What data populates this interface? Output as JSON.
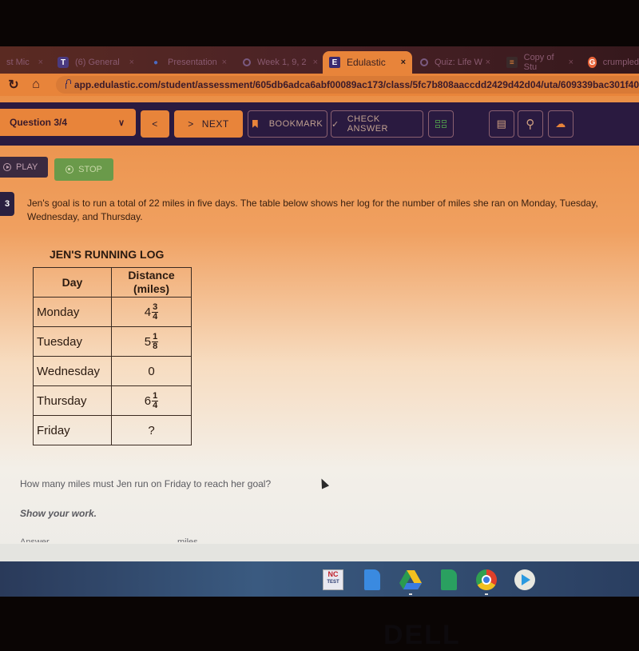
{
  "browser": {
    "tabs": [
      {
        "label": "st Mic",
        "icon": "unknown-icon",
        "active": false
      },
      {
        "label": "(6) General",
        "icon": "teams-icon",
        "active": false
      },
      {
        "label": "Presentation",
        "icon": "droplet-icon",
        "active": false
      },
      {
        "label": "Week 1, 9, 2",
        "icon": "loading-icon",
        "active": false
      },
      {
        "label": "Edulastic",
        "icon": "edulastic-icon",
        "active": true
      },
      {
        "label": "Quiz: Life W",
        "icon": "loading-icon",
        "active": false
      },
      {
        "label": "Copy of Stu",
        "icon": "doc-icon",
        "active": false
      },
      {
        "label": "crumpled",
        "icon": "google-icon",
        "active": false
      }
    ],
    "tab_close_glyph": "×",
    "url": "app.edulastic.com/student/assessment/605db6adca6abf00089ac173/class/5fc7b808aaccdd2429d42d04/uta/609339bac301f40"
  },
  "header": {
    "question_selector": "Question 3/4",
    "prev_label": "<",
    "next_label": "NEXT",
    "bookmark_label": "BOOKMARK",
    "check_answer_label": "CHECK ANSWER",
    "tools": [
      "calculator-icon",
      "scratchpad-icon",
      "magnifier-icon",
      "upload-cloud-icon"
    ]
  },
  "audio": {
    "play_label": "PLAY",
    "stop_label": "STOP"
  },
  "question": {
    "number": "3",
    "text": "Jen's goal is to run a total of 22 miles in five days. The table below shows her log for the number of miles she ran on Monday, Tuesday, Wednesday, and Thursday.",
    "table_title": "JEN'S RUNNING LOG",
    "columns": [
      "Day",
      "Distance (miles)"
    ],
    "rows": [
      {
        "day": "Monday",
        "whole": "4",
        "num": "3",
        "den": "4",
        "plain": ""
      },
      {
        "day": "Tuesday",
        "whole": "5",
        "num": "1",
        "den": "8",
        "plain": ""
      },
      {
        "day": "Wednesday",
        "whole": "",
        "num": "",
        "den": "",
        "plain": "0"
      },
      {
        "day": "Thursday",
        "whole": "6",
        "num": "1",
        "den": "4",
        "plain": ""
      },
      {
        "day": "Friday",
        "whole": "",
        "num": "",
        "den": "",
        "plain": "?"
      }
    ],
    "prompt": "How many miles must Jen run on Friday to reach her goal?",
    "show_work": "Show your work.",
    "answer_label": "Answer",
    "answer_unit": "miles"
  },
  "shelf": {
    "apps": [
      "NC Test",
      "Google Docs",
      "Google Drive",
      "Google Sheets",
      "Chrome",
      "Play Store"
    ],
    "nc_top": "NC",
    "nc_bottom": "TEST"
  },
  "bezel": {
    "brand": "DELL"
  }
}
